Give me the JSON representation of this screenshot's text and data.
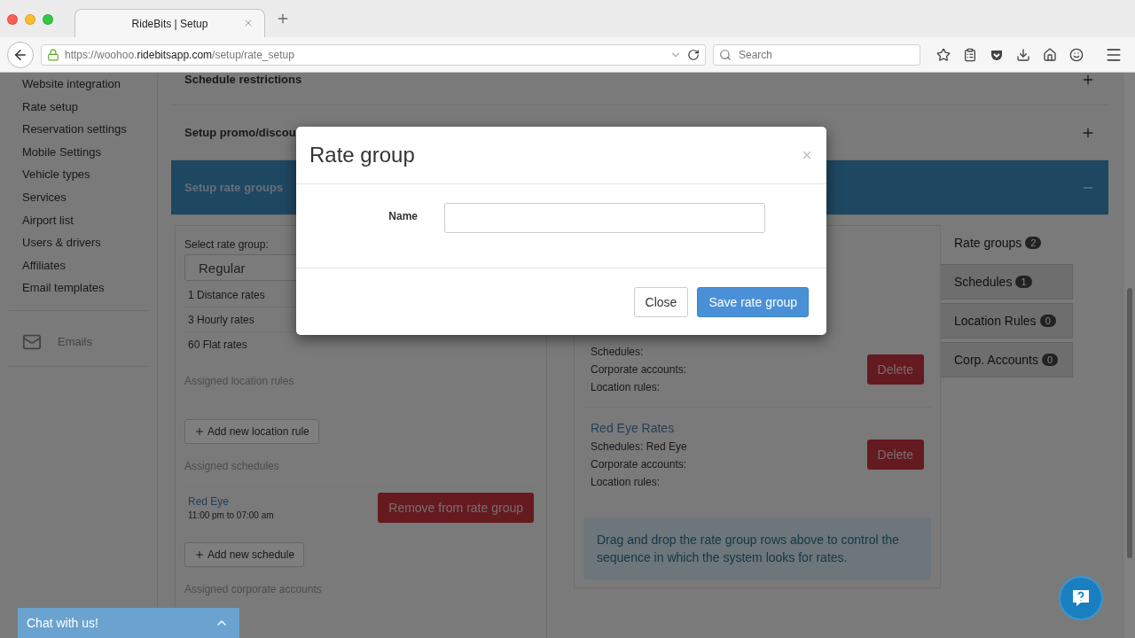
{
  "browser": {
    "tab_title": "RideBits | Setup",
    "url": {
      "prefix": "https://woohoo.",
      "domain": "ridebitsapp.com",
      "path": "/setup/rate_setup"
    },
    "search": {
      "placeholder": "Search"
    }
  },
  "sidebar": {
    "items": [
      "Website integration",
      "Rate setup",
      "Reservation settings",
      "Mobile Settings",
      "Vehicle types",
      "Services",
      "Airport list",
      "Users & drivers",
      "Affiliates",
      "Email templates"
    ],
    "footer_link": "Emails"
  },
  "sections": [
    {
      "title": "Schedule restrictions",
      "expanded": false
    },
    {
      "title": "Setup promo/discou",
      "expanded": false
    },
    {
      "title": "Setup rate groups",
      "expanded": true
    }
  ],
  "rate_group_editor": {
    "select_label": "Select rate group:",
    "select_value": "Regular",
    "rate_counts": [
      "1 Distance rates",
      "3 Hourly rates",
      "60 Flat rates"
    ],
    "location_rules_heading": "Assigned location rules",
    "add_location_rule": "Add new location rule",
    "schedules_heading": "Assigned schedules",
    "schedules": [
      {
        "name": "Red Eye",
        "time": "11:00 pm to 07:00 am",
        "remove": "Remove from rate group"
      }
    ],
    "add_schedule": "Add new schedule",
    "corporate_heading": "Assigned corporate accounts"
  },
  "rate_groups": [
    {
      "lines": [
        "Schedules:",
        "Corporate accounts:",
        "Location rules:"
      ],
      "delete": "Delete"
    },
    {
      "name": "Red Eye Rates",
      "lines": [
        "Schedules: Red Eye",
        "Corporate accounts:",
        "Location rules:"
      ],
      "delete": "Delete"
    }
  ],
  "hint": "Drag and drop the rate group rows above to control the sequence in which the system looks for rates.",
  "tabs": [
    {
      "label": "Rate groups",
      "count": "2",
      "selected": true
    },
    {
      "label": "Schedules",
      "count": "1",
      "selected": false
    },
    {
      "label": "Location Rules",
      "count": "0",
      "selected": false
    },
    {
      "label": "Corp. Accounts",
      "count": "0",
      "selected": false
    }
  ],
  "chat": {
    "label": "Chat with us!"
  },
  "modal": {
    "title": "Rate group",
    "field_label": "Name",
    "buttons": [
      {
        "label": "Close",
        "kind": "default"
      },
      {
        "label": "Save rate group",
        "kind": "primary"
      }
    ]
  }
}
